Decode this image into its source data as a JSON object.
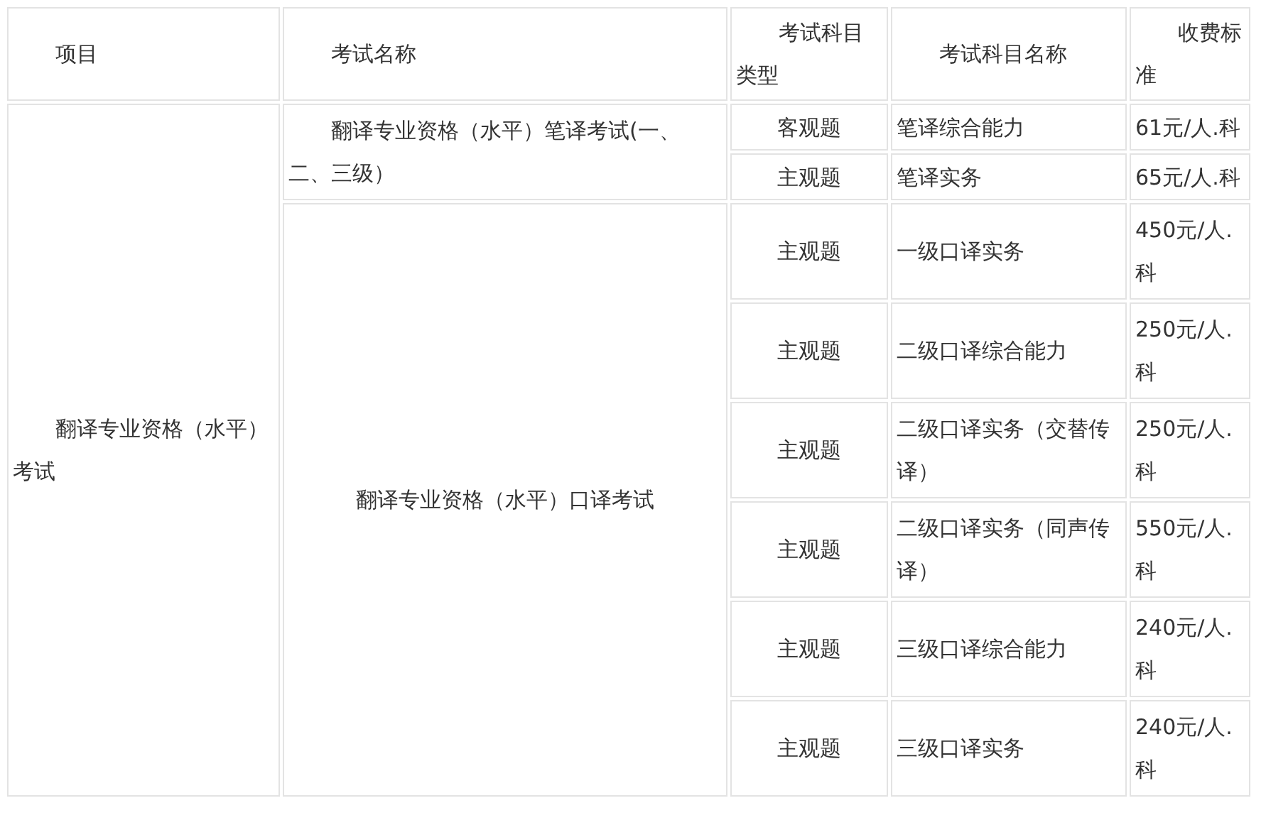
{
  "columns": [
    "项目",
    "考试名称",
    "考试科目类型",
    "考试科目名称",
    "收费标准"
  ],
  "groups": [
    {
      "project": "翻译专业资格（水平）考试",
      "exams": [
        {
          "name": "翻译专业资格（水平）笔译考试(一、二、三级）",
          "kind": "indented",
          "subjects": [
            {
              "type": "客观题",
              "name": "笔译综合能力",
              "fee": "61元/人.科"
            },
            {
              "type": "主观题",
              "name": "笔译实务",
              "fee": "65元/人.科"
            }
          ]
        },
        {
          "name": "翻译专业资格（水平）口译考试",
          "kind": "centered",
          "subjects": [
            {
              "type": "主观题",
              "name": "一级口译实务",
              "fee": "450元/人.科"
            },
            {
              "type": "主观题",
              "name": "二级口译综合能力",
              "fee": "250元/人.科"
            },
            {
              "type": "主观题",
              "name": "二级口译实务（交替传译）",
              "fee": "250元/人.科"
            },
            {
              "type": "主观题",
              "name": "二级口译实务（同声传译）",
              "fee": "550元/人.科"
            },
            {
              "type": "主观题",
              "name": "三级口译综合能力",
              "fee": "240元/人.科"
            },
            {
              "type": "主观题",
              "name": "三级口译实务",
              "fee": "240元/人.科"
            }
          ]
        }
      ]
    }
  ]
}
